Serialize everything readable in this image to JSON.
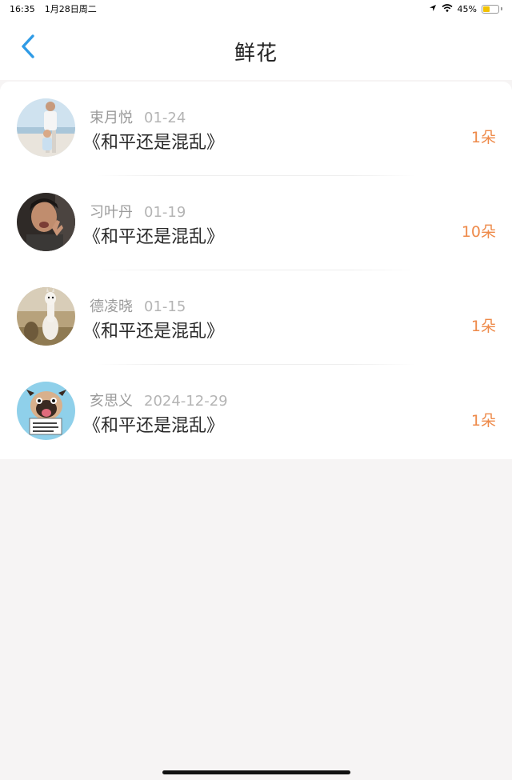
{
  "status_bar": {
    "time": "16:35",
    "date": "1月28日周二",
    "battery": "45%",
    "battery_level": 0.45,
    "icons": [
      "location-arrow-icon",
      "wifi-icon",
      "battery-icon"
    ]
  },
  "nav": {
    "title": "鲜花",
    "back_icon": "chevron-left-icon"
  },
  "colors": {
    "accent_blue": "#2f9be6",
    "count_orange": "#ee8a4a"
  },
  "items": [
    {
      "user": "束月悦",
      "date": "01-24",
      "book": "《和平还是混乱》",
      "count": "1朵"
    },
    {
      "user": "习叶丹",
      "date": "01-19",
      "book": "《和平还是混乱》",
      "count": "10朵"
    },
    {
      "user": "德凌晓",
      "date": "01-15",
      "book": "《和平还是混乱》",
      "count": "1朵"
    },
    {
      "user": "亥思义",
      "date": "2024-12-29",
      "book": "《和平还是混乱》",
      "count": "1朵"
    }
  ]
}
